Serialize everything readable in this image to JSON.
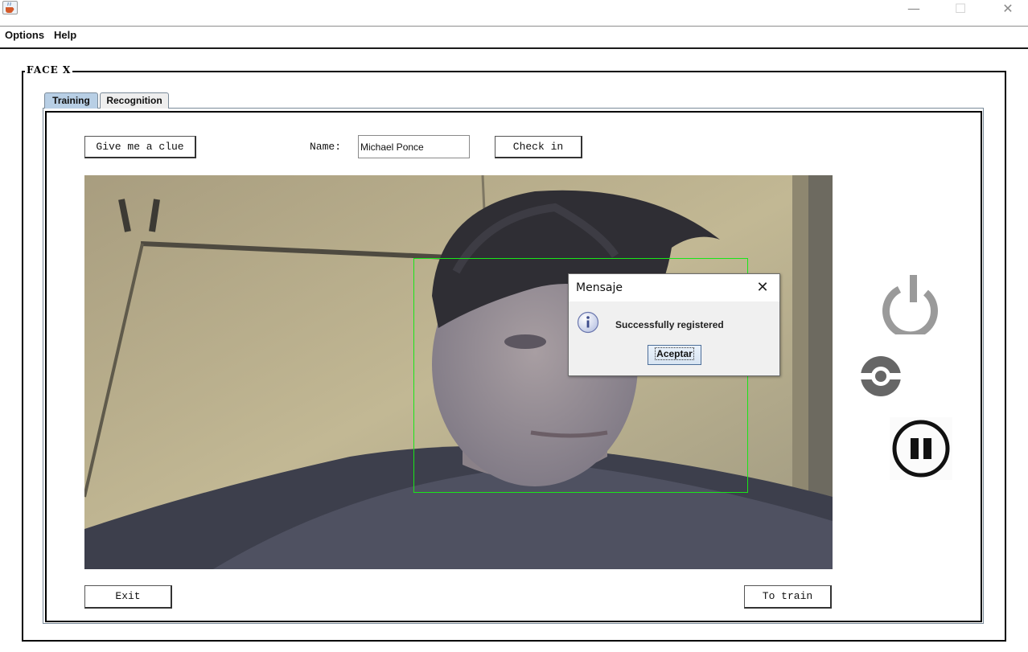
{
  "window": {
    "minimize_glyph": "—",
    "maximize_glyph": "☐",
    "close_glyph": "✕",
    "app_icon": "java-coffee-icon"
  },
  "menu": {
    "items": [
      "Options",
      "Help"
    ]
  },
  "frame": {
    "title": "FACE X"
  },
  "tabs": [
    {
      "label": "Training",
      "selected": true
    },
    {
      "label": "Recognition",
      "selected": false
    }
  ],
  "training": {
    "clue_button": "Give me a clue",
    "name_label": "Name:",
    "name_value": "Michael Ponce",
    "checkin_button": "Check in",
    "exit_button": "Exit",
    "train_button": "To train"
  },
  "camera": {
    "detection_color": "#19e619"
  },
  "side_controls": {
    "icons": [
      "power-icon",
      "capture-icon",
      "pause-icon"
    ]
  },
  "dialog": {
    "title": "Mensaje",
    "close_glyph": "✕",
    "message": "Successfully registered",
    "ok_button": "Aceptar",
    "icon": "info-icon"
  },
  "colors": {
    "tab_selected": "#b8cfe5",
    "icon_gray": "#9a9a9a",
    "icon_dark": "#666666"
  }
}
